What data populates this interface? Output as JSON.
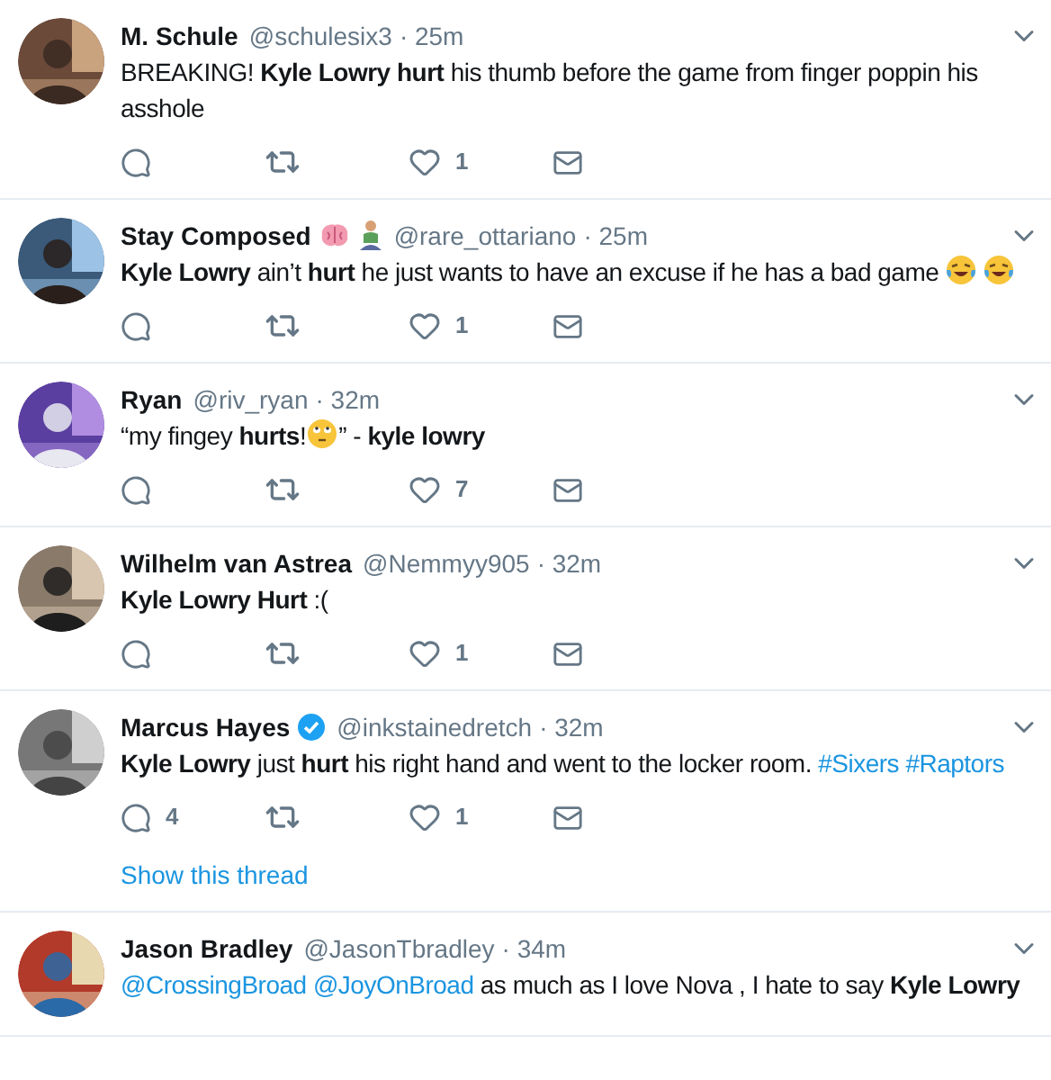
{
  "tweets": [
    {
      "name": "M. Schule",
      "handle": "@schulesix3",
      "time": "· 25m",
      "verified": false,
      "body": [
        {
          "kind": "text",
          "text": "BREAKING! **Kyle Lowry hurt** his thumb before the game from finger poppin his asshole"
        }
      ],
      "actions": {
        "likes": "1"
      }
    },
    {
      "name": "Stay Composed",
      "handle": "@rare_ottariano",
      "time": "· 25m",
      "verified": false,
      "badges": [
        {
          "kind": "brain"
        },
        {
          "kind": "person"
        }
      ],
      "body": [
        {
          "kind": "text",
          "text": "**Kyle Lowry** ain’t **hurt** he just wants to have an excuse if he has a bad game "
        },
        {
          "kind": "laughing_emoji"
        },
        {
          "kind": "laughing_emoji"
        }
      ],
      "actions": {
        "likes": "1"
      }
    },
    {
      "name": "Ryan",
      "handle": "@riv_ryan",
      "time": "· 32m",
      "verified": false,
      "body": [
        {
          "kind": "text",
          "text": "“my fingey **hurts**!"
        },
        {
          "kind": "eyeroll_emoji"
        },
        {
          "kind": "text",
          "text": "” - **kyle lowry**"
        }
      ],
      "actions": {
        "likes": "7"
      }
    },
    {
      "name": "Wilhelm van Astrea",
      "handle": "@Nemmyy905",
      "time": "· 32m",
      "verified": false,
      "body": [
        {
          "kind": "text",
          "text": "**Kyle Lowry Hurt** :("
        }
      ],
      "actions": {
        "likes": "1"
      }
    },
    {
      "name": "Marcus Hayes",
      "handle": "@inkstainedretch",
      "time": "· 32m",
      "verified": true,
      "body": [
        {
          "kind": "text",
          "text": "**Kyle Lowry** just **hurt** his right hand and went to the locker room. "
        },
        {
          "kind": "link",
          "text": "#Sixers"
        },
        {
          "kind": "link",
          "text": "#Raptors"
        }
      ],
      "actions": {
        "replies": "4",
        "likes": "1"
      },
      "thread_link": "Show this thread"
    },
    {
      "name": "Jason Bradley",
      "handle": "@JasonTbradley",
      "time": "· 34m",
      "verified": false,
      "body": [
        {
          "kind": "link",
          "text": "@CrossingBroad"
        },
        {
          "kind": "link",
          "text": "@JoyOnBroad"
        },
        {
          "kind": "text",
          "text": " as much as I love Nova , I hate to say **Kyle Lowry**"
        }
      ]
    }
  ]
}
